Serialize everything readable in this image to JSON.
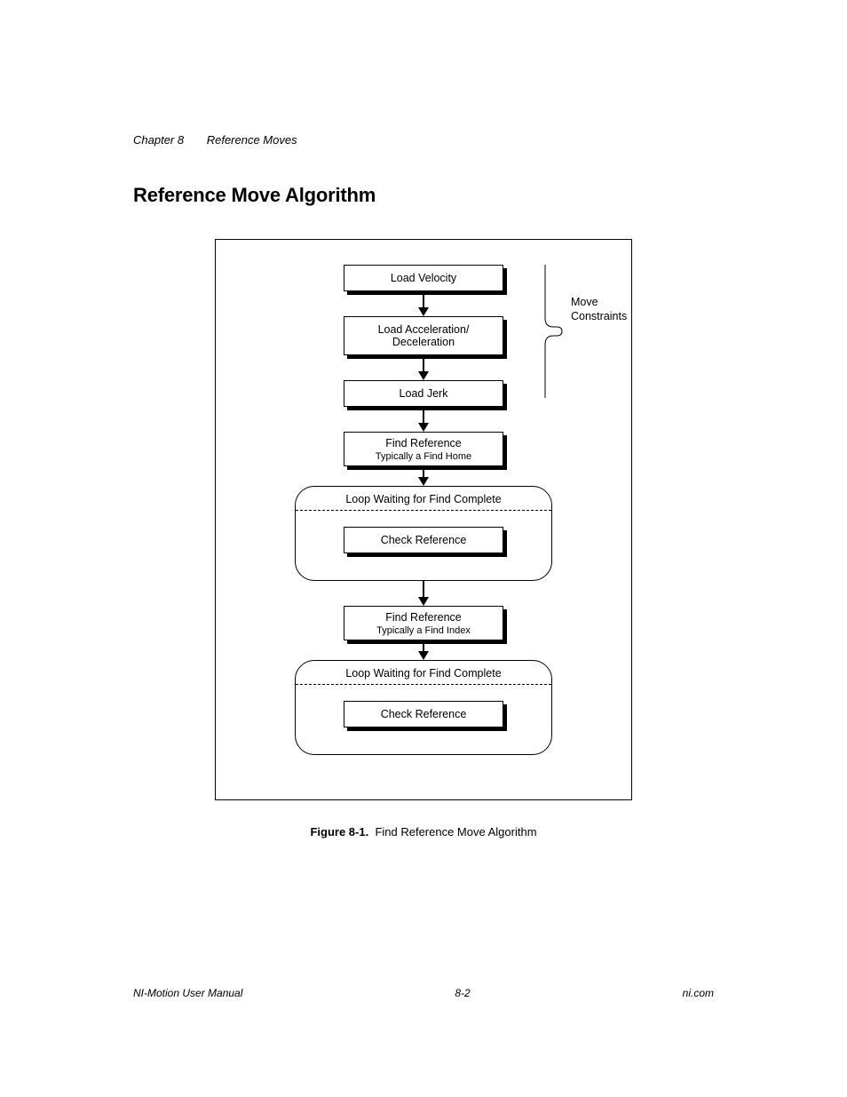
{
  "header": {
    "chapter_num": "Chapter 8",
    "chapter_title": "Reference Moves"
  },
  "section_heading": "Reference Move Algorithm",
  "diagram": {
    "box_velocity": "Load Velocity",
    "box_accel": "Load Acceleration/\nDeceleration",
    "box_jerk": "Load Jerk",
    "bracket_label": "Move\nConstraints",
    "box_findref1_line1": "Find Reference",
    "box_findref1_line2": "Typically a Find Home",
    "loop1_title": "Loop Waiting for Find Complete",
    "loop1_box": "Check Reference",
    "box_findref2_line1": "Find Reference",
    "box_findref2_line2": "Typically a Find Index",
    "loop2_title": "Loop Waiting for Find Complete",
    "loop2_box": "Check Reference"
  },
  "caption": {
    "label": "Figure 8-1.",
    "text": "Find Reference Move Algorithm"
  },
  "footer": {
    "left": "NI-Motion User Manual",
    "center": "8-2",
    "right": "ni.com"
  }
}
